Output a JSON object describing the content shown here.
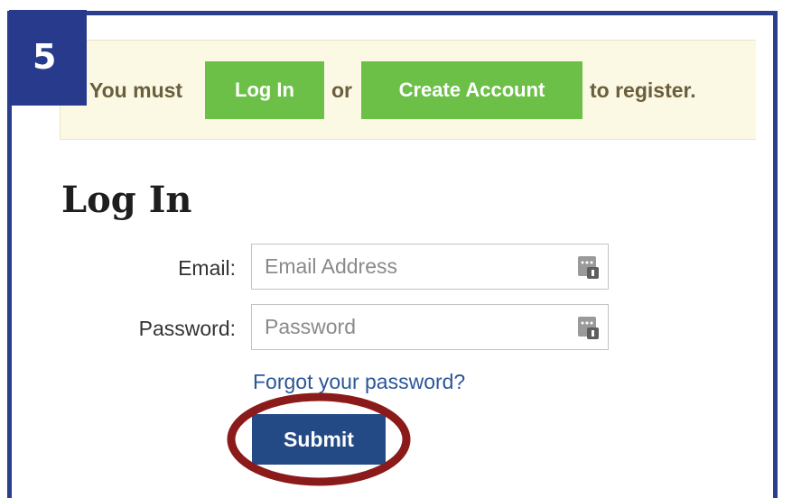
{
  "step": {
    "number": "5"
  },
  "notice": {
    "prefix": "You must",
    "login_label": "Log In",
    "or": "or",
    "create_label": "Create Account",
    "suffix": "to register."
  },
  "login_form": {
    "heading": "Log In",
    "email": {
      "label": "Email:",
      "placeholder": "Email Address",
      "value": ""
    },
    "password": {
      "label": "Password:",
      "placeholder": "Password",
      "value": ""
    },
    "forgot_label": "Forgot your password?",
    "submit_label": "Submit"
  },
  "icons": {
    "field_icon": "password-manager-key-icon",
    "highlight": "red-ellipse-highlight"
  },
  "colors": {
    "frame": "#2a3e8c",
    "notice_bg": "#fbf8e4",
    "green_button": "#6cc048",
    "submit_button": "#244a85",
    "link": "#2b5797",
    "highlight": "#8b1a1a"
  }
}
